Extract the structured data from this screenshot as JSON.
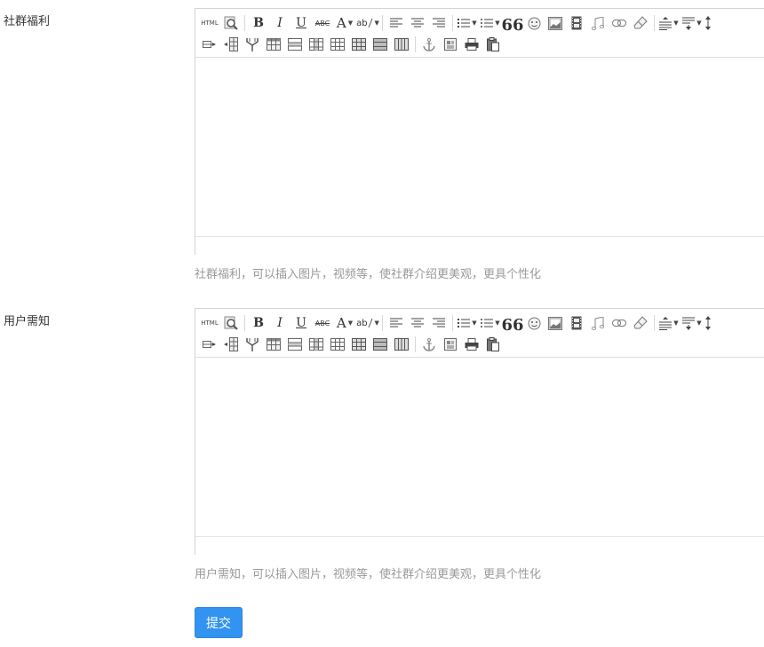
{
  "fields": [
    {
      "label": "社群福利",
      "hint": "社群福利，可以插入图片，视频等，使社群介绍更美观，更具个性化"
    },
    {
      "label": "用户需知",
      "hint": "用户需知，可以插入图片，视频等，使社群介绍更美观，更具个性化"
    }
  ],
  "toolbar": {
    "html_label": "HTML",
    "bold_label": "B",
    "italic_label": "I",
    "underline_label": "U",
    "strike_label": "ABC",
    "fontcolor_label": "A",
    "highlight_label": "ab",
    "quote_label": "66",
    "row1_icons": [
      "html-source-icon",
      "preview-icon",
      "bold-icon",
      "italic-icon",
      "underline-icon",
      "strikethrough-icon",
      "font-color-icon",
      "highlight-color-icon",
      "align-left-icon",
      "align-center-icon",
      "align-right-icon",
      "ordered-list-icon",
      "unordered-list-icon",
      "blockquote-icon",
      "emoji-icon",
      "image-icon",
      "video-icon",
      "music-icon",
      "link-icon",
      "eraser-icon",
      "line-height-icon",
      "paragraph-spacing-icon",
      "vertical-spacing-icon"
    ],
    "row2_icons": [
      "insert-row-icon",
      "insert-column-icon",
      "merge-cells-icon",
      "table-icon",
      "delete-row-icon",
      "delete-column-icon",
      "split-cells-icon",
      "table-properties-icon",
      "delete-table-icon",
      "anchor-icon",
      "template-icon",
      "print-icon",
      "paste-icon"
    ]
  },
  "submit": {
    "label": "提交"
  }
}
